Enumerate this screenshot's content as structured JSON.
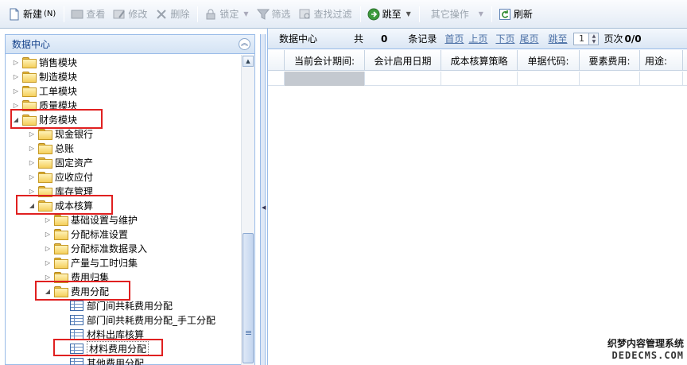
{
  "toolbar": {
    "new": "新建",
    "new_shortcut": "(N)",
    "view": "查看",
    "edit": "修改",
    "delete": "删除",
    "lock": "锁定",
    "filter": "筛选",
    "find_filter": "查找过滤",
    "goto": "跳至",
    "other_ops": "其它操作",
    "refresh": "刷新"
  },
  "left_panel": {
    "title": "数据中心",
    "tree": [
      {
        "label": "销售模块"
      },
      {
        "label": "制造模块"
      },
      {
        "label": "工单模块"
      },
      {
        "label": "质量模块"
      },
      {
        "label": "财务模块"
      },
      {
        "label": "现金银行"
      },
      {
        "label": "总账"
      },
      {
        "label": "固定资产"
      },
      {
        "label": "应收应付"
      },
      {
        "label": "库存管理"
      },
      {
        "label": "成本核算"
      },
      {
        "label": "基础设置与维护"
      },
      {
        "label": "分配标准设置"
      },
      {
        "label": "分配标准数据录入"
      },
      {
        "label": "产量与工时归集"
      },
      {
        "label": "费用归集"
      },
      {
        "label": "费用分配"
      },
      {
        "label": "部门间共耗费用分配"
      },
      {
        "label": "部门间共耗费用分配_手工分配"
      },
      {
        "label": "材料出库核算"
      },
      {
        "label": "材料费用分配"
      },
      {
        "label": "其他费用分配"
      }
    ]
  },
  "right_panel": {
    "pager": {
      "title": "数据中心",
      "total_prefix": "共",
      "total_count": "0",
      "records_suffix": "条记录",
      "first": "首页",
      "prev": "上页",
      "next": "下页",
      "last": "尾页",
      "goto": "跳至",
      "page_value": "1",
      "page_label": "页次",
      "page_count": "0/0"
    },
    "columns": [
      "当前会计期间:",
      "会计启用日期",
      "成本核算策略",
      "单据代码:",
      "要素费用:",
      "用途:"
    ]
  },
  "watermark": {
    "line1": "织梦内容管理系统",
    "line2": "DEDECMS.COM"
  }
}
